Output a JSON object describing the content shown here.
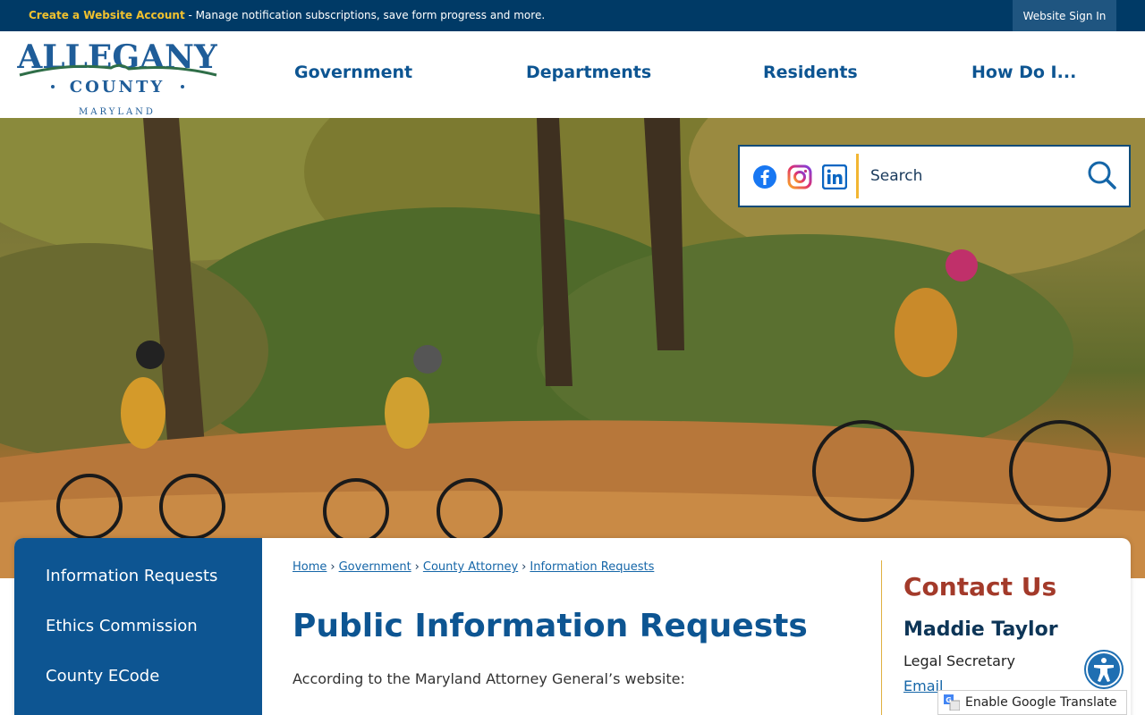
{
  "topbar": {
    "create_label": "Create a Website Account",
    "message": " - Manage notification subscriptions, save form progress and more.",
    "signin_label": "Website Sign In"
  },
  "logo": {
    "line1": "ALLEGANY",
    "line2": "COUNTY",
    "line3": "MARYLAND"
  },
  "nav": {
    "items": [
      "Government",
      "Departments",
      "Residents",
      "How Do I..."
    ]
  },
  "search": {
    "placeholder": "Search",
    "social_icons": [
      "facebook-icon",
      "instagram-icon",
      "linkedin-icon"
    ]
  },
  "sidebar": {
    "items": [
      "Information Requests",
      "Ethics Commission",
      "County ECode"
    ]
  },
  "breadcrumb": {
    "items": [
      "Home",
      "Government",
      "County Attorney",
      "Information Requests"
    ],
    "separator": "›"
  },
  "main": {
    "title": "Public Information Requests",
    "intro": "According to the Maryland Attorney General’s website:"
  },
  "contact": {
    "title": "Contact Us",
    "name": "Maddie Taylor",
    "role": "Legal Secretary",
    "email_label": "Email"
  },
  "translate": {
    "label": "Enable Google Translate"
  },
  "colors": {
    "navy": "#003a66",
    "brand_blue": "#0d5592",
    "gold": "#f2c12e",
    "contact_red": "#a33a2a"
  }
}
